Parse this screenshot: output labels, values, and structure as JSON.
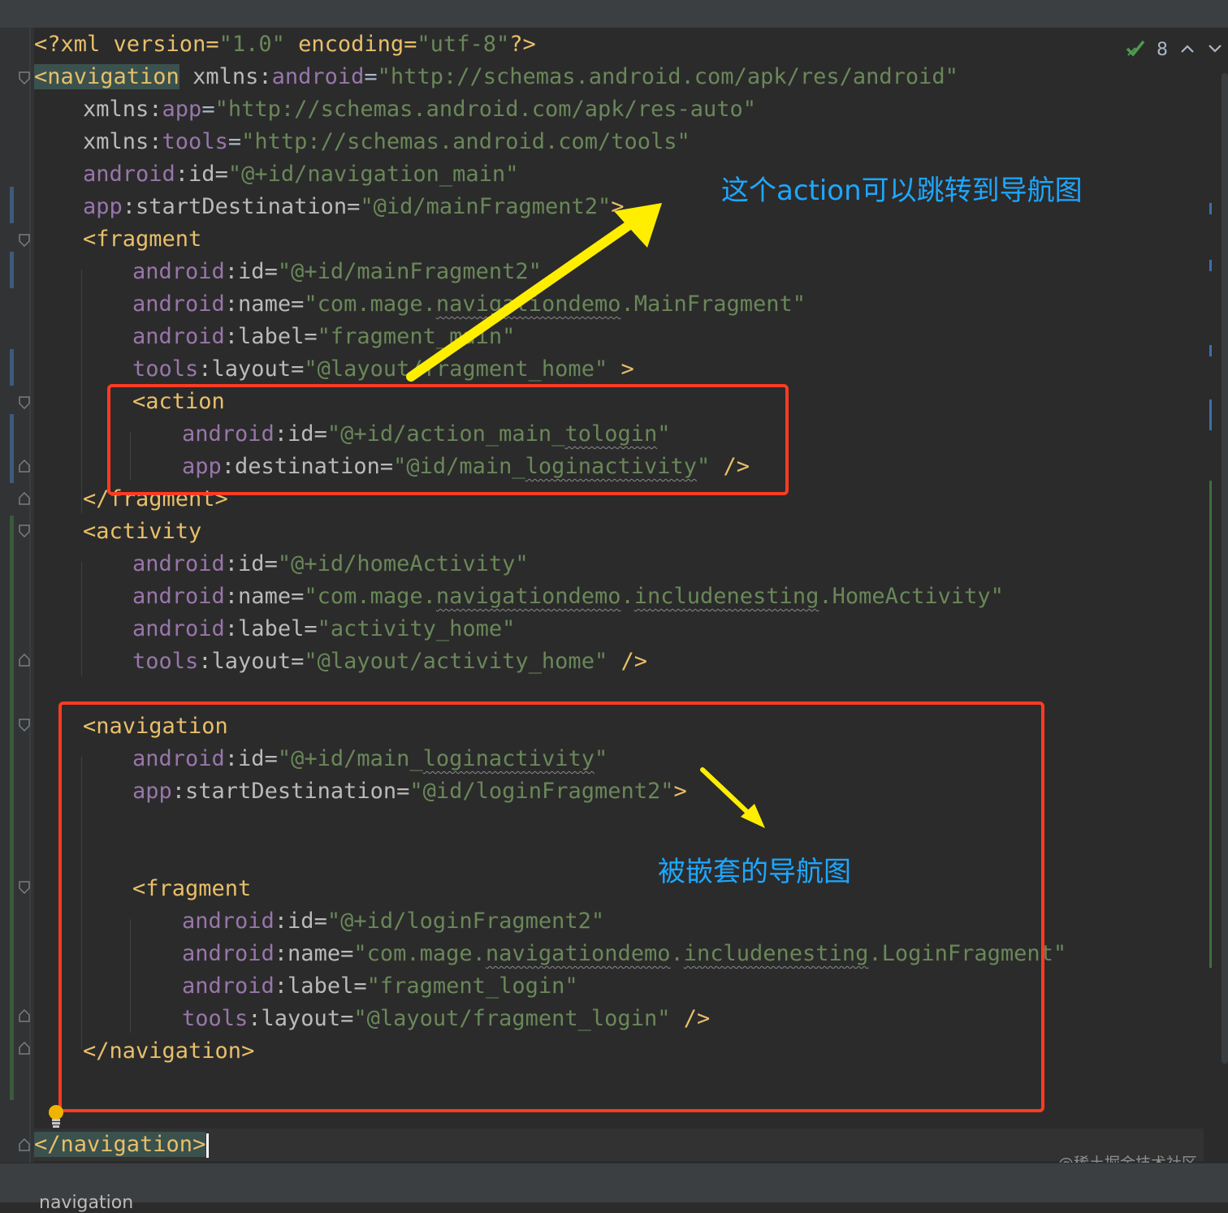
{
  "inspection": {
    "warning_count": "8"
  },
  "annotations": {
    "top_label": "这个action可以跳转到导航图",
    "nested_label": "被嵌套的导航图"
  },
  "watermark": "@稀土掘金技术社区",
  "breadcrumb": "navigation",
  "colors": {
    "background": "#2b2b2b",
    "tag": "#e8bf6a",
    "namespace": "#9876aa",
    "string": "#6a8759",
    "annotation_box": "#ff3b22",
    "annotation_arrow": "#ffee00",
    "annotation_text": "#1ea7ff"
  },
  "code": {
    "l1": {
      "a": "<?xml version=",
      "b": "\"1.0\"",
      "c": " encoding=",
      "d": "\"utf-8\"",
      "e": "?>"
    },
    "l2": {
      "a": "<navigation",
      "b": " xmlns:",
      "c": "android",
      "d": "=",
      "e": "\"http://schemas.android.com/apk/res/android\""
    },
    "l3": {
      "a": "xmlns:",
      "b": "app",
      "c": "=",
      "d": "\"http://schemas.android.com/apk/res-auto\""
    },
    "l4": {
      "a": "xmlns:",
      "b": "tools",
      "c": "=",
      "d": "\"http://schemas.android.com/tools\""
    },
    "l5": {
      "a": "android",
      "b": ":id=",
      "c": "\"@+id/navigation_main\""
    },
    "l6": {
      "a": "app",
      "b": ":startDestination=",
      "c": "\"@id/mainFragment2\"",
      "d": ">"
    },
    "l7": {
      "a": "<fragment"
    },
    "l8": {
      "a": "android",
      "b": ":id=",
      "c": "\"@+id/mainFragment2\""
    },
    "l9": {
      "a": "android",
      "b": ":name=",
      "c": "\"com.mage.",
      "d": "navigationdemo",
      "e": ".MainFragment\""
    },
    "l10": {
      "a": "android",
      "b": ":label=",
      "c": "\"fragment_main\""
    },
    "l11": {
      "a": "tools",
      "b": ":layout=",
      "c": "\"@layout/fragment_home\"",
      "d": " >"
    },
    "l12": {
      "a": "<action"
    },
    "l13": {
      "a": "android",
      "b": ":id=",
      "c": "\"@+id/action_main_",
      "d": "tologin",
      "e": "\""
    },
    "l14": {
      "a": "app",
      "b": ":destination=",
      "c": "\"@id/main_",
      "d": "loginactivity",
      "e": "\"",
      "f": " />"
    },
    "l15": {
      "a": "</fragment>"
    },
    "l16": {
      "a": "<activity"
    },
    "l17": {
      "a": "android",
      "b": ":id=",
      "c": "\"@+id/homeActivity\""
    },
    "l18": {
      "a": "android",
      "b": ":name=",
      "c": "\"com.mage.",
      "d": "navigationdemo",
      "e": ".",
      "f": "includenesting",
      "g": ".HomeActivity\""
    },
    "l19": {
      "a": "android",
      "b": ":label=",
      "c": "\"activity_home\""
    },
    "l20": {
      "a": "tools",
      "b": ":layout=",
      "c": "\"@layout/activity_home\"",
      "d": " />"
    },
    "l22": {
      "a": "<navigation"
    },
    "l23": {
      "a": "android",
      "b": ":id=",
      "c": "\"@+id/main_",
      "d": "loginactivity",
      "e": "\""
    },
    "l24": {
      "a": "app",
      "b": ":startDestination=",
      "c": "\"@id/loginFragment2\"",
      "d": ">"
    },
    "l27": {
      "a": "<fragment"
    },
    "l28": {
      "a": "android",
      "b": ":id=",
      "c": "\"@+id/loginFragment2\""
    },
    "l29": {
      "a": "android",
      "b": ":name=",
      "c": "\"com.mage.",
      "d": "navigationdemo",
      "e": ".",
      "f": "includenesting",
      "g": ".LoginFragment\""
    },
    "l30": {
      "a": "android",
      "b": ":label=",
      "c": "\"fragment_login\""
    },
    "l31": {
      "a": "tools",
      "b": ":layout=",
      "c": "\"@layout/fragment_login\"",
      "d": " />"
    },
    "l32": {
      "a": "</navigation>"
    },
    "l35": {
      "a": "</navigation>"
    }
  }
}
